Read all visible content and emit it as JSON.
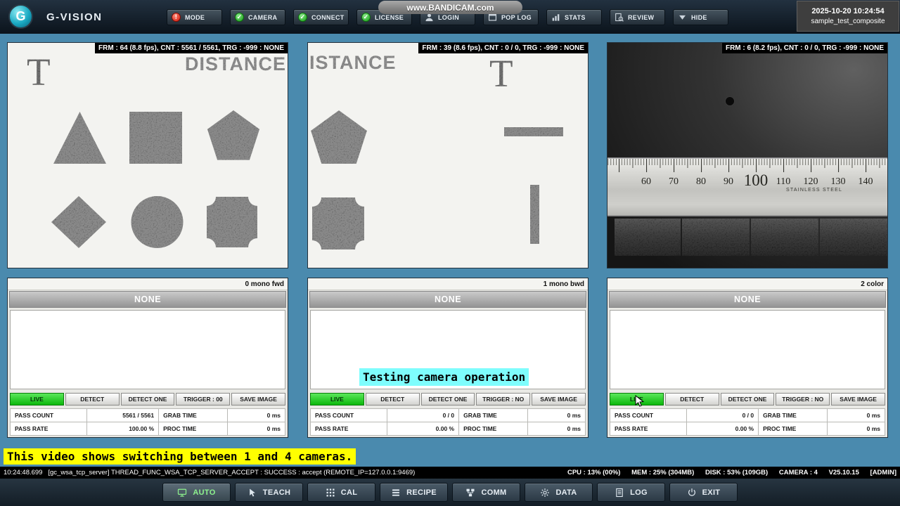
{
  "app": {
    "title": "G-VISION",
    "logo_letter": "G",
    "watermark": "www.BANDICAM.com",
    "datetime": "2025-10-20 10:24:54",
    "recipe_name": "sample_test_composite"
  },
  "icons": {
    "alert": "!",
    "check": "✓"
  },
  "topbar": {
    "buttons": [
      {
        "label": "MODE"
      },
      {
        "label": "CAMERA"
      },
      {
        "label": "CONNECT"
      },
      {
        "label": "LICENSE"
      },
      {
        "label": "LOGIN"
      },
      {
        "label": "POP LOG"
      },
      {
        "label": "STATS"
      },
      {
        "label": "REVIEW"
      },
      {
        "label": "HIDE"
      }
    ]
  },
  "cameras": [
    {
      "frame_info": "FRM : 64 (8.8 fps), CNT : 5561 / 5561, TRG : -999 : NONE",
      "channel_label": "0 mono fwd",
      "result": "NONE",
      "buttons": [
        "LIVE",
        "DETECT",
        "DETECT ONE",
        "TRIGGER : 00",
        "SAVE IMAGE"
      ],
      "stats": [
        [
          "PASS COUNT",
          "5561 / 5561",
          "GRAB TIME",
          "0 ms"
        ],
        [
          "PASS RATE",
          "100.00 %",
          "PROC TIME",
          "0 ms"
        ]
      ],
      "image_texts": {
        "letter": "T",
        "word": "DISTANCE"
      }
    },
    {
      "frame_info": "FRM : 39 (8.6 fps), CNT : 0 / 0, TRG : -999 : NONE",
      "channel_label": "1 mono bwd",
      "result": "NONE",
      "buttons": [
        "LIVE",
        "DETECT",
        "DETECT ONE",
        "TRIGGER : NO",
        "SAVE IMAGE"
      ],
      "stats": [
        [
          "PASS COUNT",
          "0 / 0",
          "GRAB TIME",
          "0 ms"
        ],
        [
          "PASS RATE",
          "0.00 %",
          "PROC TIME",
          "0 ms"
        ]
      ],
      "image_texts": {
        "letter": "T",
        "word": "ISTANCE"
      }
    },
    {
      "frame_info": "FRM : 6 (8.2 fps), CNT : 0 / 0, TRG : -999 : NONE",
      "channel_label": "2 color",
      "result": "NONE",
      "buttons": [
        "LIVE",
        "DETECT",
        "DETECT ONE",
        "TRIGGER : NO",
        "SAVE IMAGE"
      ],
      "stats": [
        [
          "PASS COUNT",
          "0 / 0",
          "GRAB TIME",
          "0 ms"
        ],
        [
          "PASS RATE",
          "0.00 %",
          "PROC TIME",
          "0 ms"
        ]
      ],
      "ruler": {
        "numbers": [
          "60",
          "70",
          "80",
          "90",
          "100",
          "110",
          "120",
          "130",
          "140"
        ],
        "brand": "STAINLESS STEEL"
      }
    }
  ],
  "overlays": {
    "note": "Testing camera operation",
    "caption": "This video shows switching between 1 and 4 cameras."
  },
  "statusbar": {
    "log": "10:24:48.699   [gc_wsa_tcp_server] THREAD_FUNC_WSA_TCP_SERVER_ACCEPT : SUCCESS : accept (REMOTE_IP=127.0.0.1:9469)",
    "cpu": "CPU : 13% (00%)",
    "mem": "MEM : 25% (304MB)",
    "disk": "DISK : 53% (109GB)",
    "camera": "CAMERA : 4",
    "version": "V25.10.15",
    "user": "[ADMIN]"
  },
  "toolbar": {
    "buttons": [
      "AUTO",
      "TEACH",
      "CAL",
      "RECIPE",
      "COMM",
      "DATA",
      "LOG",
      "EXIT"
    ]
  },
  "colors": {
    "background": "#4a8aae",
    "live_green": "#0cb70c",
    "highlight_yellow": "#ffff00",
    "highlight_cyan": "#7efdfd",
    "status_green": "#119c11",
    "status_red": "#d21507"
  }
}
